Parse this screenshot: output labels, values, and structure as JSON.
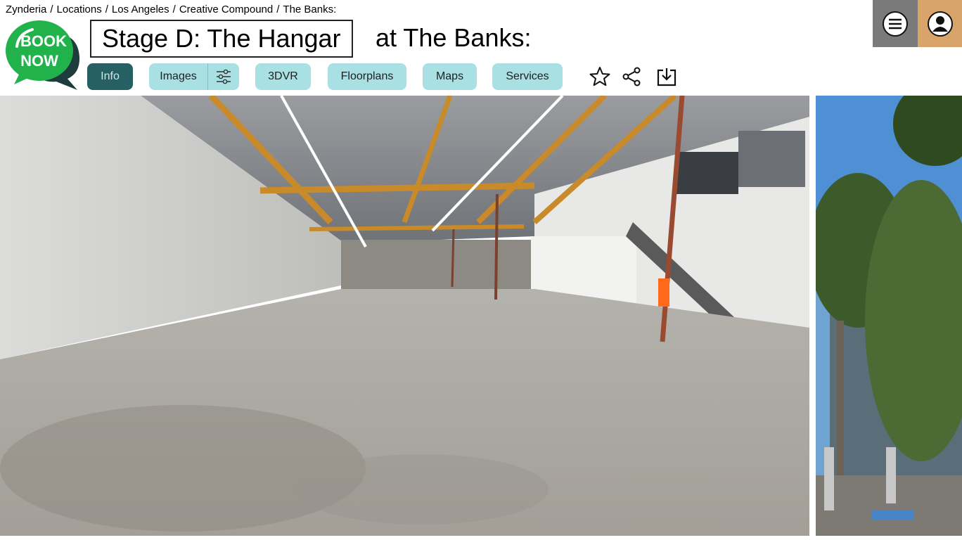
{
  "breadcrumb": {
    "items": [
      "Zynderia",
      "Locations",
      "Los Angeles",
      "Creative Compound",
      "The Banks:"
    ],
    "separator": "/"
  },
  "book_now": {
    "line1": "BOOK",
    "line2": "NOW",
    "color": "#22b24c",
    "tail_color": "#1e3b3e"
  },
  "title": {
    "main": "Stage D: The Hangar",
    "suffix": "at The Banks:"
  },
  "tabs": [
    {
      "label": "Info",
      "active": true
    },
    {
      "label": "Images",
      "active": false,
      "icon": "sliders-icon"
    },
    {
      "label": "3DVR",
      "active": false
    },
    {
      "label": "Floorplans",
      "active": false
    },
    {
      "label": "Maps",
      "active": false
    },
    {
      "label": "Services",
      "active": false
    }
  ],
  "actions": [
    "star-icon",
    "share-icon",
    "download-icon"
  ],
  "header_buttons": {
    "menu_icon": "hamburger-menu-icon",
    "profile_icon": "user-profile-icon"
  },
  "colors": {
    "tab_bg": "#a8e0e4",
    "tab_active_bg": "#266065",
    "menu_bg": "#7a7a7a",
    "profile_bg": "#d9a36c"
  },
  "gallery": {
    "main_image": "warehouse interior photo",
    "side_image": "building exterior photo"
  }
}
